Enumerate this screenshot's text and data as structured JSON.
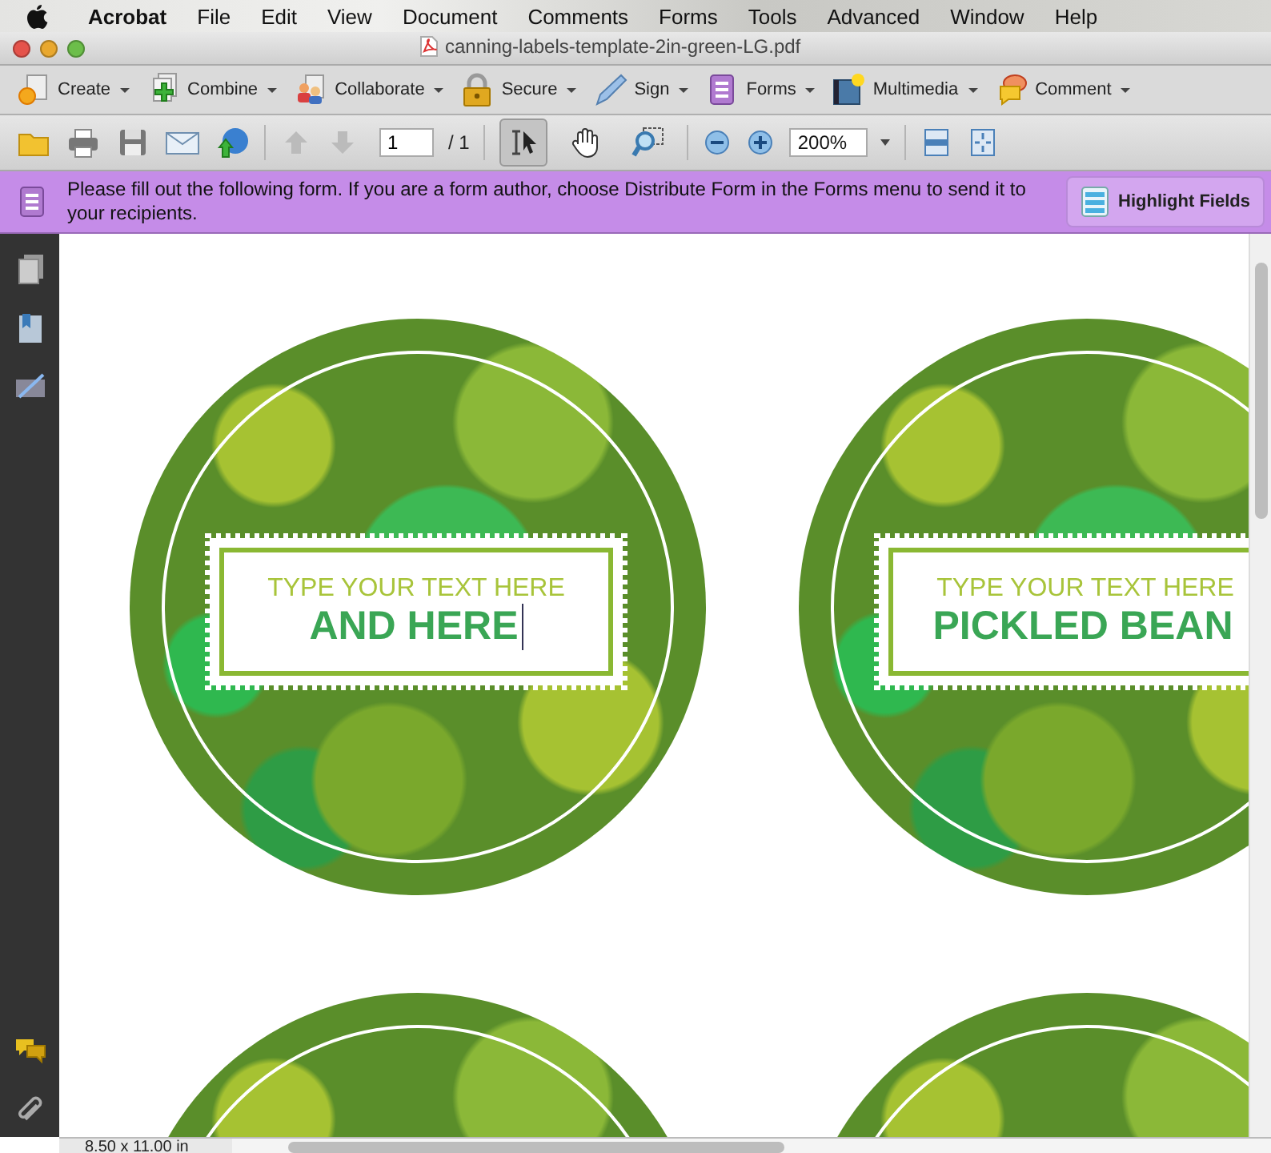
{
  "menu_bar": {
    "items": [
      {
        "label": "Acrobat",
        "app": true
      },
      {
        "label": "File",
        "app": false
      },
      {
        "label": "Edit",
        "app": false
      },
      {
        "label": "View",
        "app": false
      },
      {
        "label": "Document",
        "app": false
      },
      {
        "label": "Comments",
        "app": false
      },
      {
        "label": "Forms",
        "app": false
      },
      {
        "label": "Tools",
        "app": false
      },
      {
        "label": "Advanced",
        "app": false
      },
      {
        "label": "Window",
        "app": false
      },
      {
        "label": "Help",
        "app": false
      }
    ]
  },
  "window": {
    "title": "canning-labels-template-2in-green-LG.pdf"
  },
  "task_toolbar": [
    {
      "label": "Create"
    },
    {
      "label": "Combine"
    },
    {
      "label": "Collaborate"
    },
    {
      "label": "Secure"
    },
    {
      "label": "Sign"
    },
    {
      "label": "Forms"
    },
    {
      "label": "Multimedia"
    },
    {
      "label": "Comment"
    }
  ],
  "nav_toolbar": {
    "previous_page": {
      "disabled": true
    },
    "next_page": {
      "disabled": true
    },
    "page": "1",
    "page_count": "/ 1",
    "tools": [
      {
        "selected": true
      },
      {
        "selected": false
      },
      {
        "selected": false
      }
    ],
    "zoom": "200%"
  },
  "form_bar": {
    "message": "Please fill out the following form. If you are a form author, choose Distribute Form in the Forms menu to send it to your recipients.",
    "button": "Highlight Fields"
  },
  "labels": [
    {
      "kind": "full",
      "line_1": "TYPE YOUR TEXT HERE",
      "line_2": "AND HERE",
      "focused": true
    },
    {
      "kind": "full",
      "line_1": "TYPE YOUR TEXT HERE",
      "line_2": "PICKLED BEAN",
      "focused": false
    },
    {
      "kind": "edge"
    },
    {
      "kind": "edge"
    }
  ],
  "status_bar": {
    "page_size": "8.50 x 11.00 in"
  }
}
